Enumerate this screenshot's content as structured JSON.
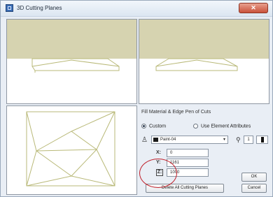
{
  "window": {
    "title": "3D Cutting Planes",
    "close_glyph": "✕"
  },
  "panel": {
    "group_label": "Fill Material & Edge Pen of Cuts",
    "radio_custom": "Custom",
    "radio_use_element": "Use Element Attributes",
    "selected_radio": "custom",
    "fill_icon": "fill-bucket-icon",
    "fill_glyph": "♙",
    "material_value": "Paint-04",
    "dropdown_arrow": "▾",
    "pen_icon": "pen-icon",
    "pen_glyph": "⚲",
    "pen_value": "1"
  },
  "coords": [
    {
      "label": "X:",
      "value": "0"
    },
    {
      "label": "Y:",
      "value": "1161"
    },
    {
      "label": "Z:",
      "value": "1000"
    }
  ],
  "buttons": {
    "delete_all": "Delete All Cutting Planes",
    "ok": "OK",
    "cancel": "Cancel"
  },
  "colors": {
    "section_fill": "#d6d3b0",
    "wire": "#b9b978",
    "highlight": "#c0202a"
  }
}
